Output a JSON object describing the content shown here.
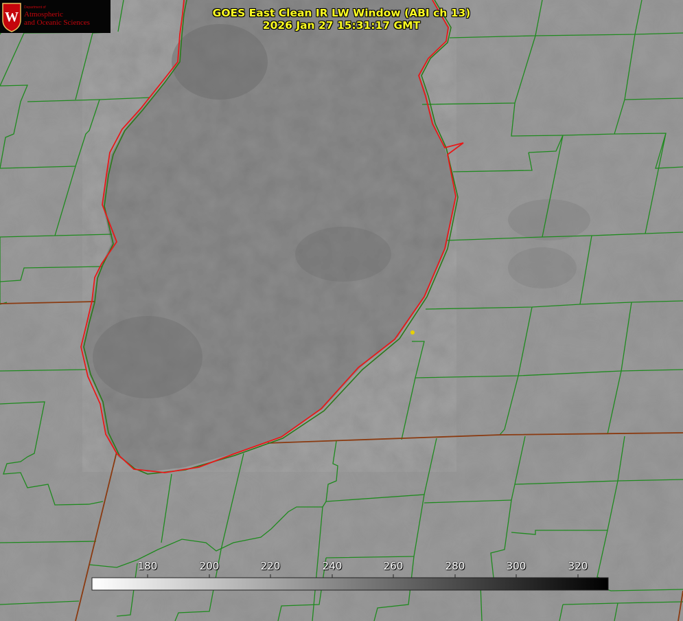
{
  "logo": {
    "dept_line": "Department of",
    "name_line1": "Atmospheric",
    "name_line2": "and Oceanic Sciences",
    "accent_color": "#c5050c"
  },
  "title": {
    "line1": "GOES East Clean IR LW Window (ABI ch 13)",
    "line2": "2026 Jan 27 15:31:17 GMT"
  },
  "colorbar": {
    "ticks": [
      "180",
      "200",
      "220",
      "240",
      "260",
      "280",
      "300",
      "320"
    ],
    "start_color": "#ffffff",
    "end_color": "#000000"
  },
  "colors": {
    "county_lines": "#1e8a1e",
    "state_lines": "#8a3a10",
    "lake_outline": "#e81818",
    "marker": "#e8d000",
    "title_text": "#ffff22"
  }
}
